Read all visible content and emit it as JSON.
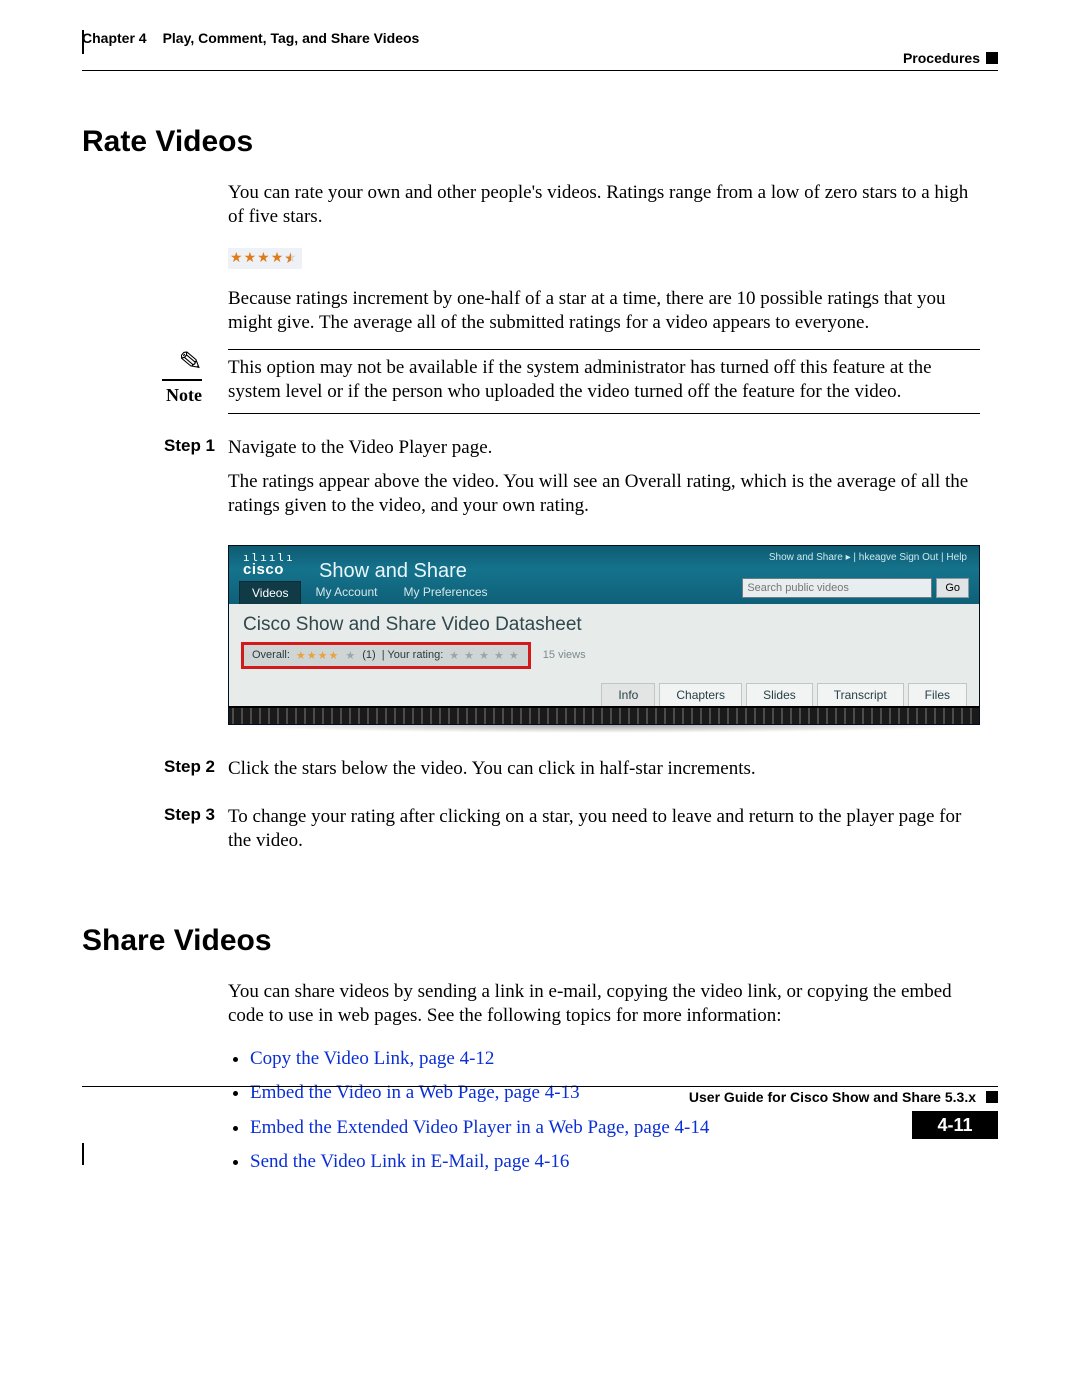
{
  "header": {
    "chapter_label": "Chapter 4",
    "chapter_title": "Play, Comment, Tag, and Share Videos",
    "section_label": "Procedures"
  },
  "rate": {
    "heading": "Rate Videos",
    "p1": "You can rate your own and other people's videos. Ratings range from a low of zero stars to a high of five stars.",
    "p2": "Because ratings increment by one-half of a star at a time, there are 10 possible ratings that you might give. The average all of the submitted ratings for a video appears to everyone.",
    "note_label": "Note",
    "note_body": "This option may not be available if the system administrator has turned off this feature at the system level or if the person who uploaded the video turned off the feature for the video.",
    "steps": [
      {
        "label": "Step 1",
        "p1": "Navigate to the Video Player page.",
        "p2": "The ratings appear above the video. You will see an Overall rating, which is the average of all the ratings given to the video, and your own rating."
      },
      {
        "label": "Step 2",
        "p1": "Click the stars below the video. You can click in half-star increments."
      },
      {
        "label": "Step 3",
        "p1": "To change your rating after clicking on a star, you need to leave and return to the player page for the video."
      }
    ]
  },
  "figure": {
    "logo_brand": "cisco",
    "product": "Show and Share",
    "top_links": "Show and Share  ▸  |  hkeagve Sign Out  |  Help",
    "nav": {
      "videos": "Videos",
      "account": "My Account",
      "prefs": "My Preferences"
    },
    "search_placeholder": "Search public videos",
    "go": "Go",
    "page_title": "Cisco Show and Share Video Datasheet",
    "overall_label": "Overall:",
    "overall_count": "(1)",
    "your_rating_label": "| Your rating:",
    "views": "15 views",
    "tabs2": {
      "info": "Info",
      "chapters": "Chapters",
      "slides": "Slides",
      "transcript": "Transcript",
      "files": "Files"
    }
  },
  "share": {
    "heading": "Share Videos",
    "p1": "You can share videos by sending a link in e-mail, copying the video link, or copying the embed code to use in web pages. See the following topics for more information:",
    "links": [
      "Copy the Video Link, page 4-12",
      "Embed the Video in a Web Page, page 4-13",
      "Embed the Extended Video Player in a Web Page, page 4-14",
      "Send the Video Link in E-Mail, page 4-16"
    ]
  },
  "footer": {
    "guide": "User Guide for Cisco Show and Share 5.3.x",
    "page": "4-11"
  }
}
